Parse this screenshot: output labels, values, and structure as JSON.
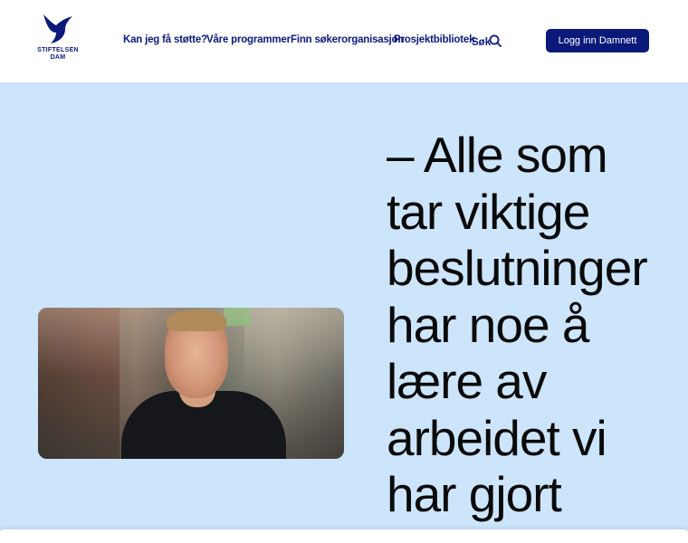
{
  "brand": {
    "logo_line1": "STIFTELSEN",
    "logo_line2": "DAM",
    "color": "#0b1a78"
  },
  "nav": {
    "items": [
      {
        "label": "Kan jeg få støtte?"
      },
      {
        "label": "Våre programmer"
      },
      {
        "label": "Finn søkerorganisasjon"
      },
      {
        "label": "Prosjektbibliotek"
      }
    ],
    "search_label": "Søk",
    "search_icon": "search-icon",
    "login_label": "Logg inn Damnett"
  },
  "hero": {
    "background": "#cde5fb",
    "quote_lines": [
      "– Alle som",
      "tar viktige",
      "beslutninger",
      "har noe å",
      "lære av",
      "arbeidet vi",
      "har gjort"
    ]
  }
}
